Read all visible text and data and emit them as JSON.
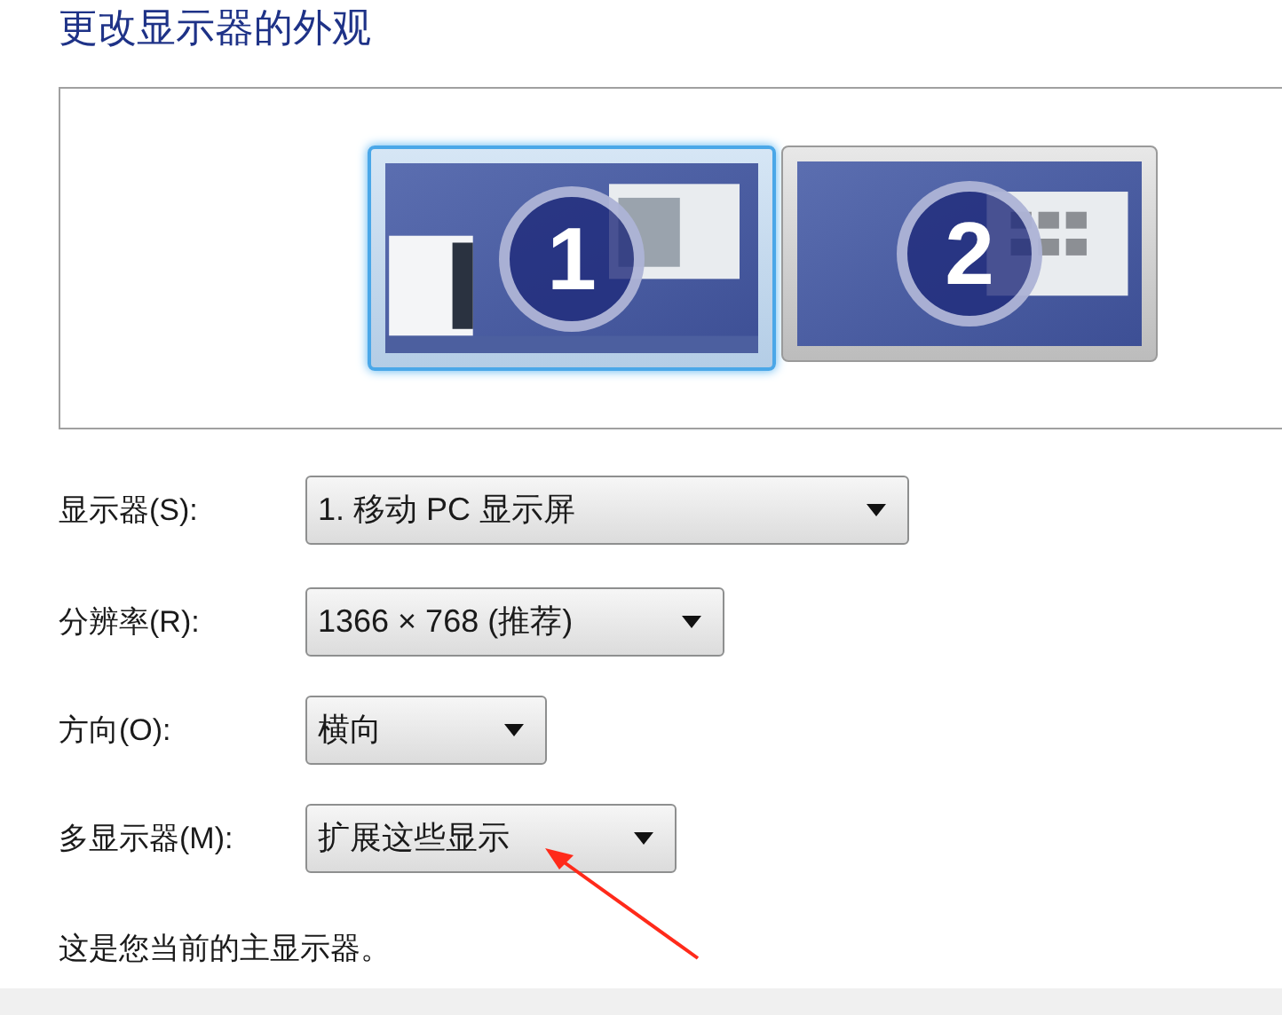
{
  "title": "更改显示器的外观",
  "monitors": [
    {
      "number": "1",
      "selected": true
    },
    {
      "number": "2",
      "selected": false
    }
  ],
  "settings": [
    {
      "label": "显示器(S):",
      "value": "1. 移动 PC 显示屏"
    },
    {
      "label": "分辨率(R):",
      "value": "1366 × 768 (推荐)"
    },
    {
      "label": "方向(O):",
      "value": "横向"
    },
    {
      "label": "多显示器(M):",
      "value": "扩展这些显示"
    }
  ],
  "note": "这是您当前的主显示器。"
}
